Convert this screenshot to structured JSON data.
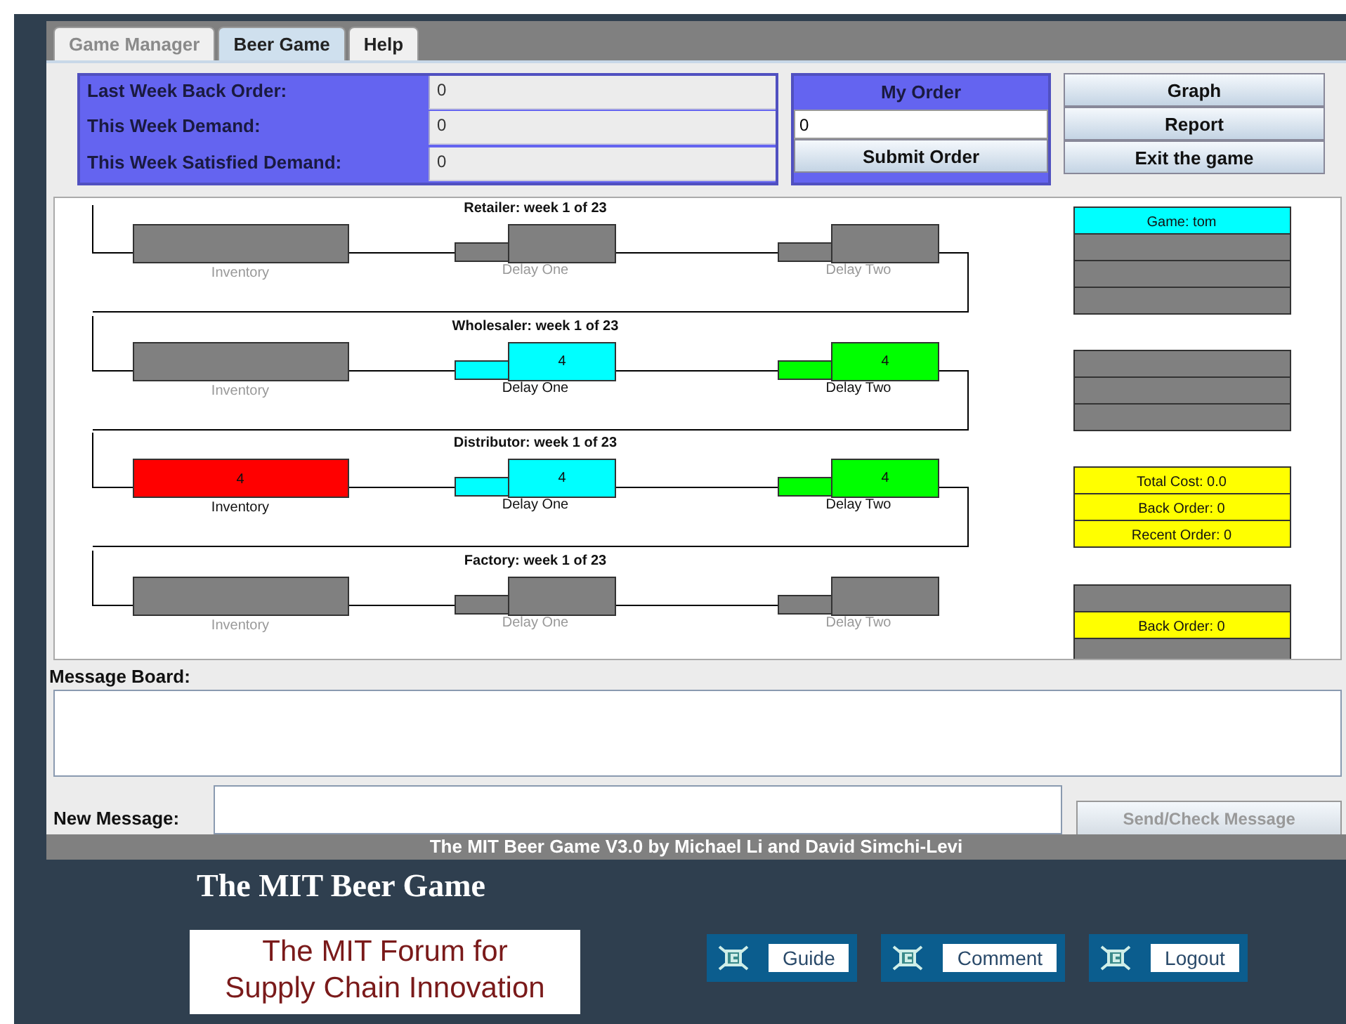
{
  "tabs": [
    {
      "label": "Game Manager",
      "selected": false,
      "disabled": true
    },
    {
      "label": "Beer Game",
      "selected": true,
      "disabled": false
    },
    {
      "label": "Help",
      "selected": false,
      "disabled": false
    }
  ],
  "status_fields": [
    {
      "label": "Last Week Back Order:",
      "value": "0"
    },
    {
      "label": "This Week Demand:",
      "value": "0"
    },
    {
      "label": "This Week Satisfied Demand:",
      "value": "0"
    }
  ],
  "my_order": {
    "title": "My Order",
    "value": "0",
    "submit": "Submit Order"
  },
  "buttons": [
    "Graph",
    "Report",
    "Exit the game"
  ],
  "stages": [
    {
      "title": "Retailer: week 1 of 23",
      "boxes": [
        {
          "kind": "inventory",
          "label": "Inventory",
          "color": "#808080",
          "active": false
        },
        {
          "kind": "delay",
          "label": "Delay One",
          "color": "#808080",
          "active": false
        },
        {
          "kind": "delay",
          "label": "Delay Two",
          "color": "#808080",
          "active": false
        }
      ],
      "info": [
        {
          "text": "Game: tom",
          "color": "#00ffff"
        },
        {
          "color": "#808080"
        },
        {
          "color": "#808080"
        },
        {
          "color": "#808080"
        }
      ]
    },
    {
      "title": "Wholesaler: week 1 of 23",
      "boxes": [
        {
          "kind": "inventory",
          "label": "Inventory",
          "color": "#808080",
          "active": false
        },
        {
          "kind": "delay",
          "label": "Delay One",
          "value": "4",
          "color": "#00ffff",
          "active": true
        },
        {
          "kind": "delay",
          "label": "Delay Two",
          "value": "4",
          "color": "#00ff00",
          "active": true
        }
      ],
      "info": [
        {
          "color": "#808080"
        },
        {
          "color": "#808080"
        },
        {
          "color": "#808080"
        }
      ]
    },
    {
      "title": "Distributor: week 1 of 23",
      "boxes": [
        {
          "kind": "inventory",
          "label": "Inventory",
          "value": "4",
          "color": "#ff0000",
          "active": true
        },
        {
          "kind": "delay",
          "label": "Delay One",
          "value": "4",
          "color": "#00ffff",
          "active": true
        },
        {
          "kind": "delay",
          "label": "Delay Two",
          "value": "4",
          "color": "#00ff00",
          "active": true
        }
      ],
      "info": [
        {
          "text": "Total Cost: 0.0",
          "color": "#ffff00"
        },
        {
          "text": "Back Order: 0",
          "color": "#ffff00"
        },
        {
          "text": "Recent Order: 0",
          "color": "#ffff00"
        }
      ]
    },
    {
      "title": "Factory: week 1 of 23",
      "boxes": [
        {
          "kind": "inventory",
          "label": "Inventory",
          "color": "#808080",
          "active": false
        },
        {
          "kind": "delay",
          "label": "Delay One",
          "color": "#808080",
          "active": false
        },
        {
          "kind": "delay",
          "label": "Delay Two",
          "color": "#808080",
          "active": false
        }
      ],
      "info": [
        {
          "color": "#808080"
        },
        {
          "text": "Back Order: 0",
          "color": "#ffff00"
        },
        {
          "color": "#808080"
        }
      ]
    }
  ],
  "message_board": {
    "label": "Message Board:"
  },
  "new_message": {
    "label": "New Message:",
    "send": "Send/Check Message"
  },
  "status_bar": "The MIT Beer Game V3.0 by Michael Li and David Simchi-Levi",
  "page_title": "The MIT Beer Game",
  "forum_logo": [
    "The MIT Forum for",
    "Supply Chain Innovation"
  ],
  "links": [
    "Guide",
    "Comment",
    "Logout"
  ]
}
